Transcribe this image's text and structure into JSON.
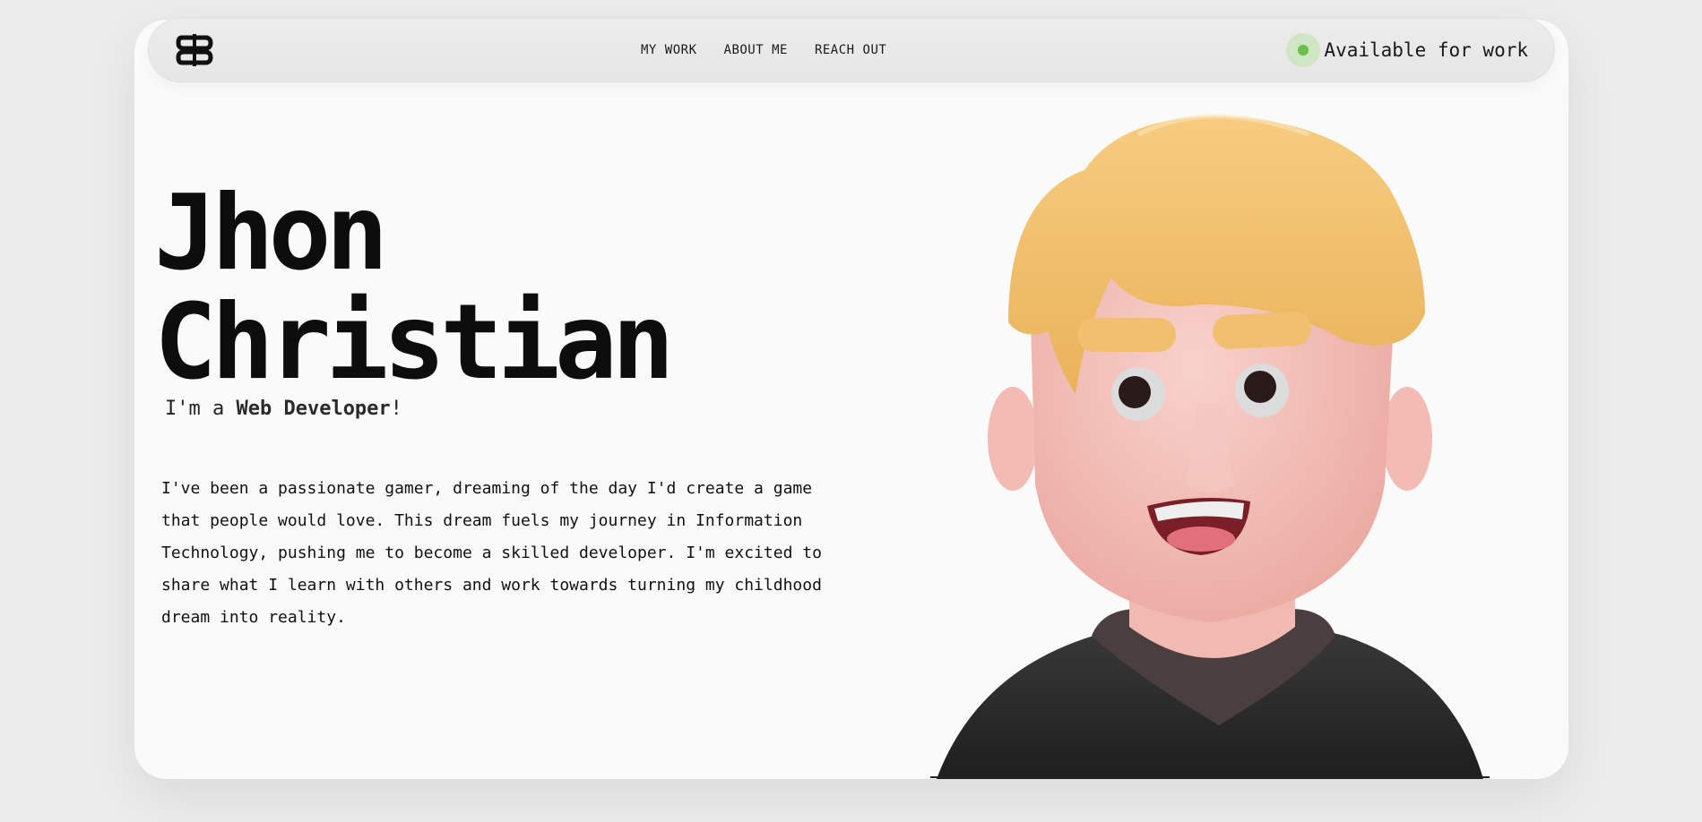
{
  "nav": {
    "links": [
      "MY WORK",
      "ABOUT ME",
      "REACH OUT"
    ],
    "status": "Available for work"
  },
  "hero": {
    "first_name": "Jhon",
    "last_name": "Christian",
    "role_prefix": "I'm a",
    "role": "Web Developer",
    "role_suffix": "!",
    "bio": "I've been a passionate gamer, dreaming of the day I'd create a game that people would love. This dream fuels my journey in Information Technology, pushing me to become a skilled developer. I'm excited to share what I learn with others and work towards turning my childhood dream into reality."
  },
  "colors": {
    "status_dot": "#6cc04a",
    "status_halo": "#cfe6c5",
    "hair": "#f1c06a",
    "skin": "#f4c4bd",
    "shirt": "#2f2f2f"
  },
  "icons": {
    "logo": "jc-monogram-icon",
    "avatar": "3d-avatar-illustration"
  }
}
